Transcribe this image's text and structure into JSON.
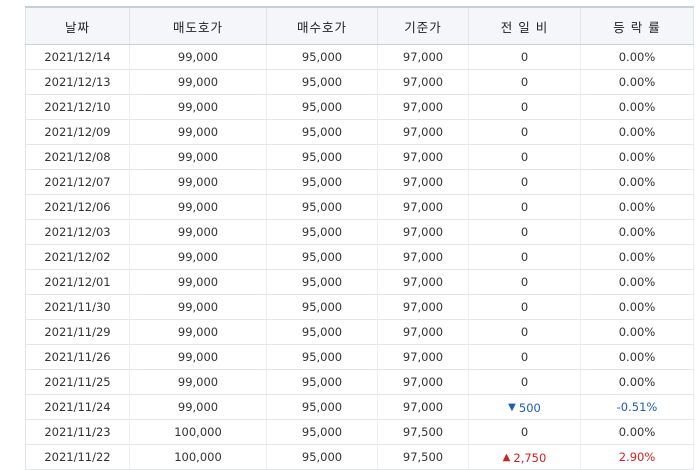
{
  "colors": {
    "up": "#d21f1f",
    "down": "#1a5fb4",
    "header_bg": "#f4f6fa"
  },
  "table": {
    "headers": [
      "날짜",
      "매도호가",
      "매수호가",
      "기준가",
      "전 일 비",
      "등 락 률"
    ],
    "rows": [
      {
        "date": "2021/12/14",
        "sell": "99,000",
        "buy": "95,000",
        "base": "97,000",
        "change": "0",
        "direction": "none",
        "direction_icon": "",
        "rate": "0.00%"
      },
      {
        "date": "2021/12/13",
        "sell": "99,000",
        "buy": "95,000",
        "base": "97,000",
        "change": "0",
        "direction": "none",
        "direction_icon": "",
        "rate": "0.00%"
      },
      {
        "date": "2021/12/10",
        "sell": "99,000",
        "buy": "95,000",
        "base": "97,000",
        "change": "0",
        "direction": "none",
        "direction_icon": "",
        "rate": "0.00%"
      },
      {
        "date": "2021/12/09",
        "sell": "99,000",
        "buy": "95,000",
        "base": "97,000",
        "change": "0",
        "direction": "none",
        "direction_icon": "",
        "rate": "0.00%"
      },
      {
        "date": "2021/12/08",
        "sell": "99,000",
        "buy": "95,000",
        "base": "97,000",
        "change": "0",
        "direction": "none",
        "direction_icon": "",
        "rate": "0.00%"
      },
      {
        "date": "2021/12/07",
        "sell": "99,000",
        "buy": "95,000",
        "base": "97,000",
        "change": "0",
        "direction": "none",
        "direction_icon": "",
        "rate": "0.00%"
      },
      {
        "date": "2021/12/06",
        "sell": "99,000",
        "buy": "95,000",
        "base": "97,000",
        "change": "0",
        "direction": "none",
        "direction_icon": "",
        "rate": "0.00%"
      },
      {
        "date": "2021/12/03",
        "sell": "99,000",
        "buy": "95,000",
        "base": "97,000",
        "change": "0",
        "direction": "none",
        "direction_icon": "",
        "rate": "0.00%"
      },
      {
        "date": "2021/12/02",
        "sell": "99,000",
        "buy": "95,000",
        "base": "97,000",
        "change": "0",
        "direction": "none",
        "direction_icon": "",
        "rate": "0.00%"
      },
      {
        "date": "2021/12/01",
        "sell": "99,000",
        "buy": "95,000",
        "base": "97,000",
        "change": "0",
        "direction": "none",
        "direction_icon": "",
        "rate": "0.00%"
      },
      {
        "date": "2021/11/30",
        "sell": "99,000",
        "buy": "95,000",
        "base": "97,000",
        "change": "0",
        "direction": "none",
        "direction_icon": "",
        "rate": "0.00%"
      },
      {
        "date": "2021/11/29",
        "sell": "99,000",
        "buy": "95,000",
        "base": "97,000",
        "change": "0",
        "direction": "none",
        "direction_icon": "",
        "rate": "0.00%"
      },
      {
        "date": "2021/11/26",
        "sell": "99,000",
        "buy": "95,000",
        "base": "97,000",
        "change": "0",
        "direction": "none",
        "direction_icon": "",
        "rate": "0.00%"
      },
      {
        "date": "2021/11/25",
        "sell": "99,000",
        "buy": "95,000",
        "base": "97,000",
        "change": "0",
        "direction": "none",
        "direction_icon": "",
        "rate": "0.00%"
      },
      {
        "date": "2021/11/24",
        "sell": "99,000",
        "buy": "95,000",
        "base": "97,000",
        "change": "500",
        "direction": "down",
        "direction_icon": "triangle-down-icon",
        "rate": "-0.51%"
      },
      {
        "date": "2021/11/23",
        "sell": "100,000",
        "buy": "95,000",
        "base": "97,500",
        "change": "0",
        "direction": "none",
        "direction_icon": "",
        "rate": "0.00%"
      },
      {
        "date": "2021/11/22",
        "sell": "100,000",
        "buy": "95,000",
        "base": "97,500",
        "change": "2,750",
        "direction": "up",
        "direction_icon": "triangle-up-icon",
        "rate": "2.90%"
      }
    ]
  }
}
